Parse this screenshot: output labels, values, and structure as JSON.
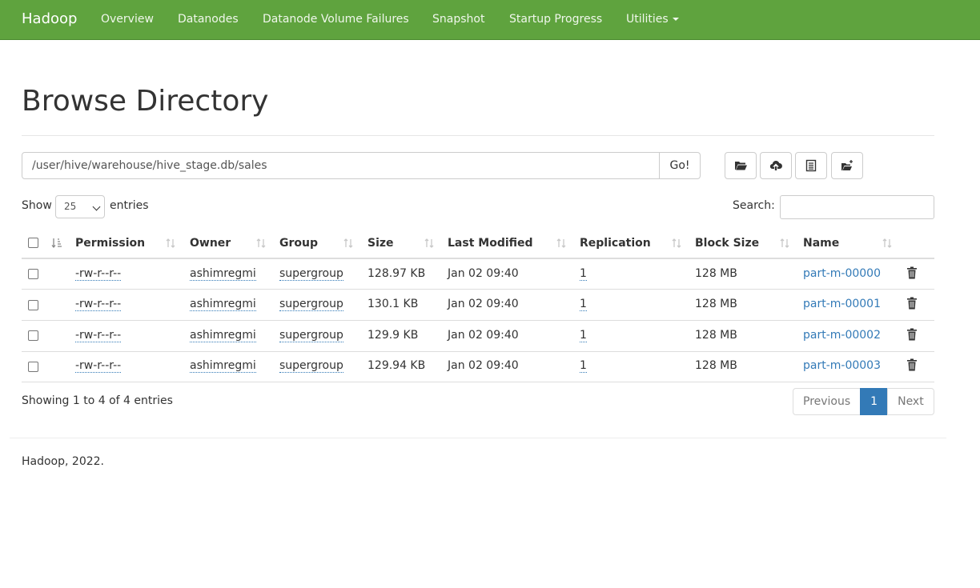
{
  "navbar": {
    "brand": "Hadoop",
    "items": [
      "Overview",
      "Datanodes",
      "Datanode Volume Failures",
      "Snapshot",
      "Startup Progress",
      "Utilities"
    ]
  },
  "page": {
    "title": "Browse Directory"
  },
  "path": {
    "value": "/user/hive/warehouse/hive_stage.db/sales",
    "go_label": "Go!"
  },
  "toolbar": {
    "icons": [
      "folder-open-icon",
      "upload-cloud-icon",
      "list-icon",
      "create-folder-icon"
    ]
  },
  "length": {
    "show_label": "Show",
    "selected": "25",
    "entries_label": "entries"
  },
  "search": {
    "label": "Search:",
    "value": ""
  },
  "table": {
    "columns": [
      "Permission",
      "Owner",
      "Group",
      "Size",
      "Last Modified",
      "Replication",
      "Block Size",
      "Name"
    ],
    "rows": [
      {
        "permission": "-rw-r--r--",
        "owner": "ashimregmi",
        "group": "supergroup",
        "size": "128.97 KB",
        "modified": "Jan 02 09:40",
        "replication": "1",
        "block_size": "128 MB",
        "name": "part-m-00000"
      },
      {
        "permission": "-rw-r--r--",
        "owner": "ashimregmi",
        "group": "supergroup",
        "size": "130.1 KB",
        "modified": "Jan 02 09:40",
        "replication": "1",
        "block_size": "128 MB",
        "name": "part-m-00001"
      },
      {
        "permission": "-rw-r--r--",
        "owner": "ashimregmi",
        "group": "supergroup",
        "size": "129.9 KB",
        "modified": "Jan 02 09:40",
        "replication": "1",
        "block_size": "128 MB",
        "name": "part-m-00002"
      },
      {
        "permission": "-rw-r--r--",
        "owner": "ashimregmi",
        "group": "supergroup",
        "size": "129.94 KB",
        "modified": "Jan 02 09:40",
        "replication": "1",
        "block_size": "128 MB",
        "name": "part-m-00003"
      }
    ]
  },
  "info": "Showing 1 to 4 of 4 entries",
  "pagination": {
    "previous": "Previous",
    "current": "1",
    "next": "Next"
  },
  "footer": "Hadoop, 2022.",
  "colors": {
    "navbar": "#5fa33e",
    "link": "#337ab7",
    "active_page": "#337ab7"
  }
}
